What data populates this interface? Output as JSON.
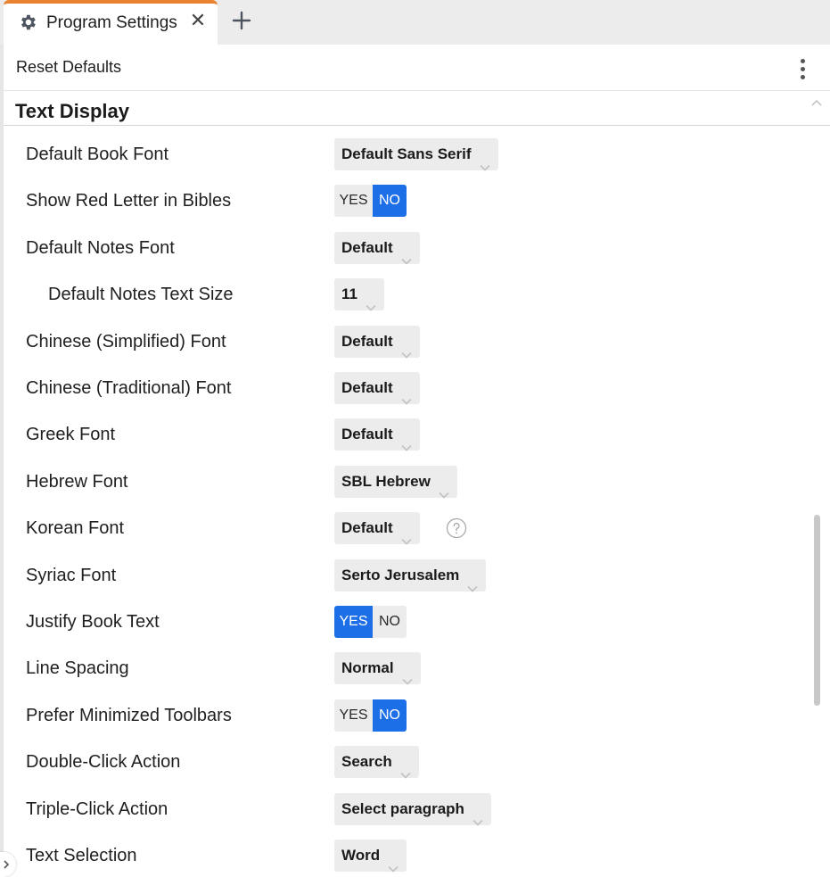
{
  "tab": {
    "title": "Program Settings",
    "icon": "gear-icon",
    "close_glyph": "✕",
    "new_tab_icon": "plus-icon",
    "accent_color": "#e8822e"
  },
  "toolbar": {
    "reset_label": "Reset Defaults",
    "menu_icon": "kebab-menu-icon"
  },
  "section": {
    "title": "Text Display",
    "collapse_icon": "chevron-up-icon"
  },
  "colors": {
    "toggle_active": "#1d6fe8",
    "control_bg": "#ececec"
  },
  "settings": [
    {
      "label": "Default Book Font",
      "type": "dropdown",
      "value": "Default Sans Serif"
    },
    {
      "label": "Show Red Letter in Bibles",
      "type": "toggle",
      "yes": "YES",
      "no": "NO",
      "selected": "NO"
    },
    {
      "label": "Default Notes Font",
      "type": "dropdown",
      "value": "Default"
    },
    {
      "label": "Default Notes Text Size",
      "type": "dropdown",
      "value": "11",
      "indent": true
    },
    {
      "label": "Chinese (Simplified) Font",
      "type": "dropdown",
      "value": "Default"
    },
    {
      "label": "Chinese (Traditional) Font",
      "type": "dropdown",
      "value": "Default"
    },
    {
      "label": "Greek Font",
      "type": "dropdown",
      "value": "Default"
    },
    {
      "label": "Hebrew Font",
      "type": "dropdown",
      "value": "SBL Hebrew"
    },
    {
      "label": "Korean Font",
      "type": "dropdown",
      "value": "Default",
      "help_icon": "question-circle-icon"
    },
    {
      "label": "Syriac Font",
      "type": "dropdown",
      "value": "Serto Jerusalem"
    },
    {
      "label": "Justify Book Text",
      "type": "toggle",
      "yes": "YES",
      "no": "NO",
      "selected": "YES"
    },
    {
      "label": "Line Spacing",
      "type": "dropdown",
      "value": "Normal"
    },
    {
      "label": "Prefer Minimized Toolbars",
      "type": "toggle",
      "yes": "YES",
      "no": "NO",
      "selected": "NO"
    },
    {
      "label": "Double-Click Action",
      "type": "dropdown",
      "value": "Search"
    },
    {
      "label": "Triple-Click Action",
      "type": "dropdown",
      "value": "Select paragraph"
    },
    {
      "label": "Text Selection",
      "type": "dropdown",
      "value": "Word"
    }
  ]
}
